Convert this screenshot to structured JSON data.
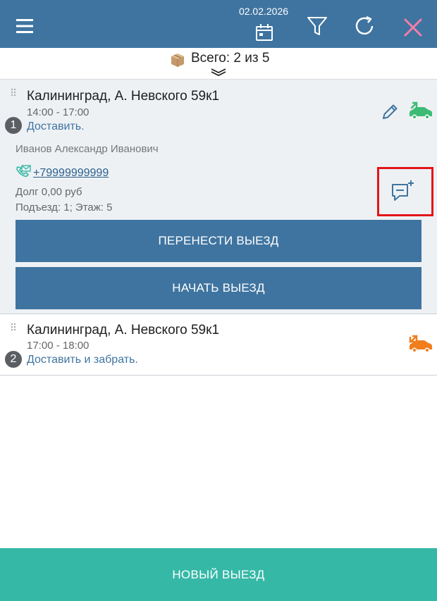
{
  "header": {
    "date": "02.02.2026",
    "icons": [
      "menu-icon",
      "calendar-icon",
      "filter-icon",
      "refresh-icon",
      "close-icon"
    ],
    "colors": {
      "bar": "#3f74a0",
      "close": "#f17fa6"
    }
  },
  "summary": {
    "text": "Всего: 2 из 5",
    "icons": [
      "box-icon",
      "chevrons-down-icon"
    ]
  },
  "trips": [
    {
      "number": "1",
      "address": "Калининград, А. Невского 59к1",
      "time": "14:00 - 17:00",
      "action": "Доставить.",
      "client": "Иванов Александр Иванович",
      "phone": "+79999999999",
      "debt": "Долг 0,00 руб",
      "entrance": "Подъезд: 1; Этаж: 5",
      "move_label": "ПЕРЕНЕСТИ ВЫЕЗД",
      "start_label": "НАЧАТЬ ВЫЕЗД",
      "car_color": "#3dbb74"
    },
    {
      "number": "2",
      "address": "Калининград, А. Невского 59к1",
      "time": "17:00 - 18:00",
      "action": "Доставить и забрать.",
      "car_color": "#f07e1c"
    }
  ],
  "footer": {
    "new_trip_label": "НОВЫЙ ВЫЕЗД",
    "color": "#36b8a7"
  }
}
